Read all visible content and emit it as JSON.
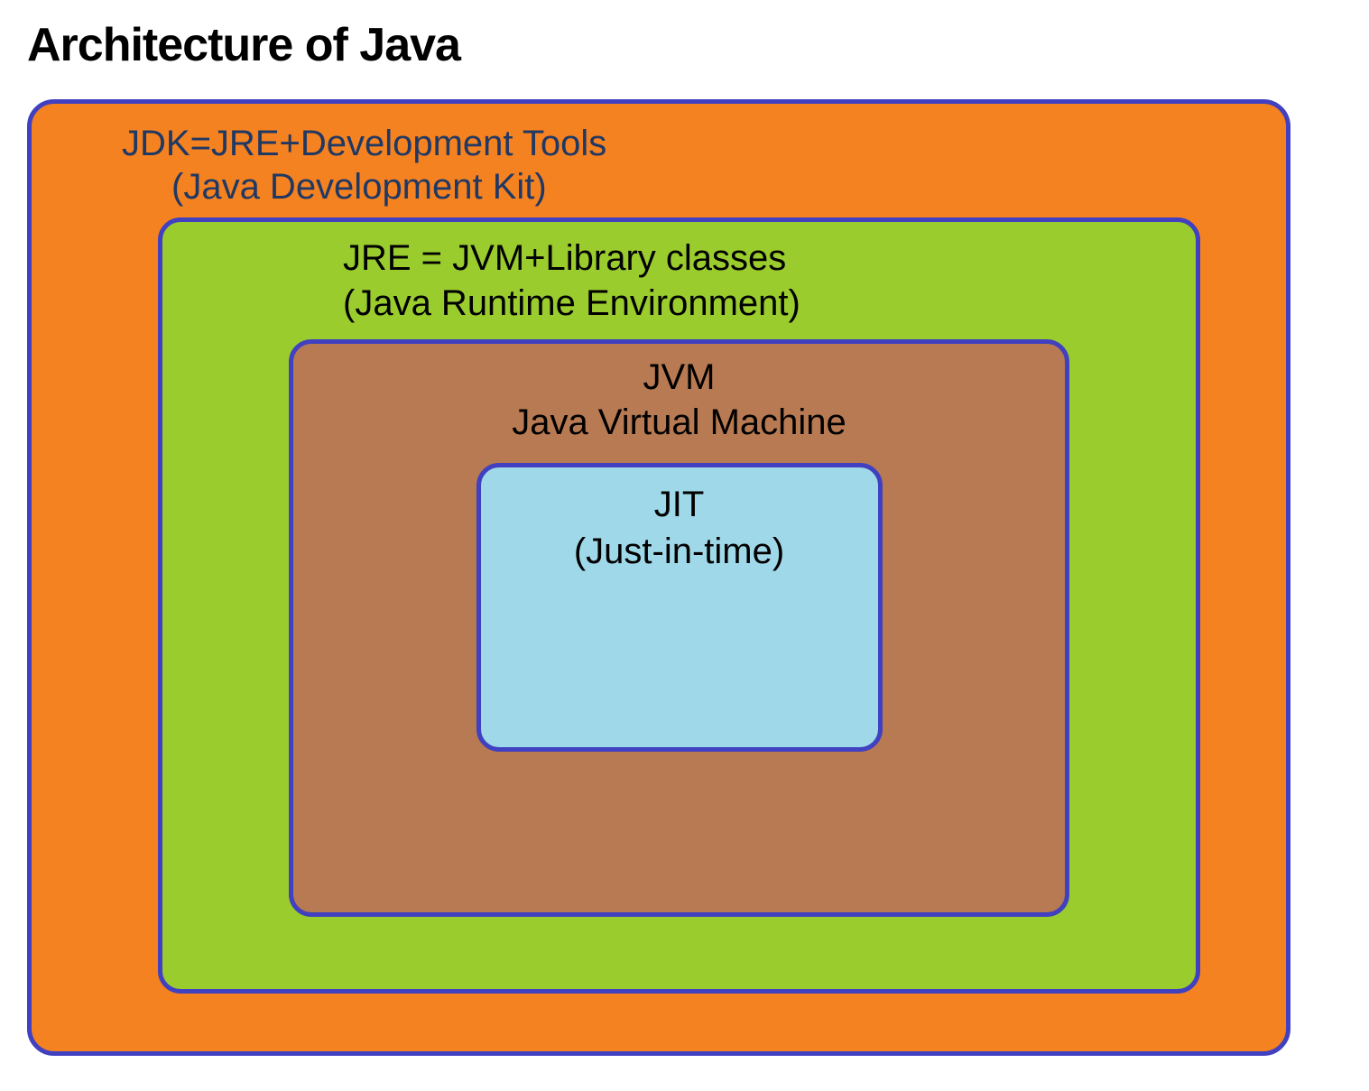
{
  "title": "Architecture of Java",
  "diagram": {
    "jdk": {
      "line1": "JDK=JRE+Development Tools",
      "line2": "(Java Development Kit)",
      "color": "#F58220"
    },
    "jre": {
      "line1": "JRE = JVM+Library classes",
      "line2": "(Java Runtime Environment)",
      "color": "#9ACC2E"
    },
    "jvm": {
      "line1": "JVM",
      "line2": "Java Virtual Machine",
      "color": "#B87A52"
    },
    "jit": {
      "line1": "JIT",
      "line2": "(Just-in-time)",
      "color": "#9FD8E8"
    },
    "border_color": "#4040C0"
  }
}
